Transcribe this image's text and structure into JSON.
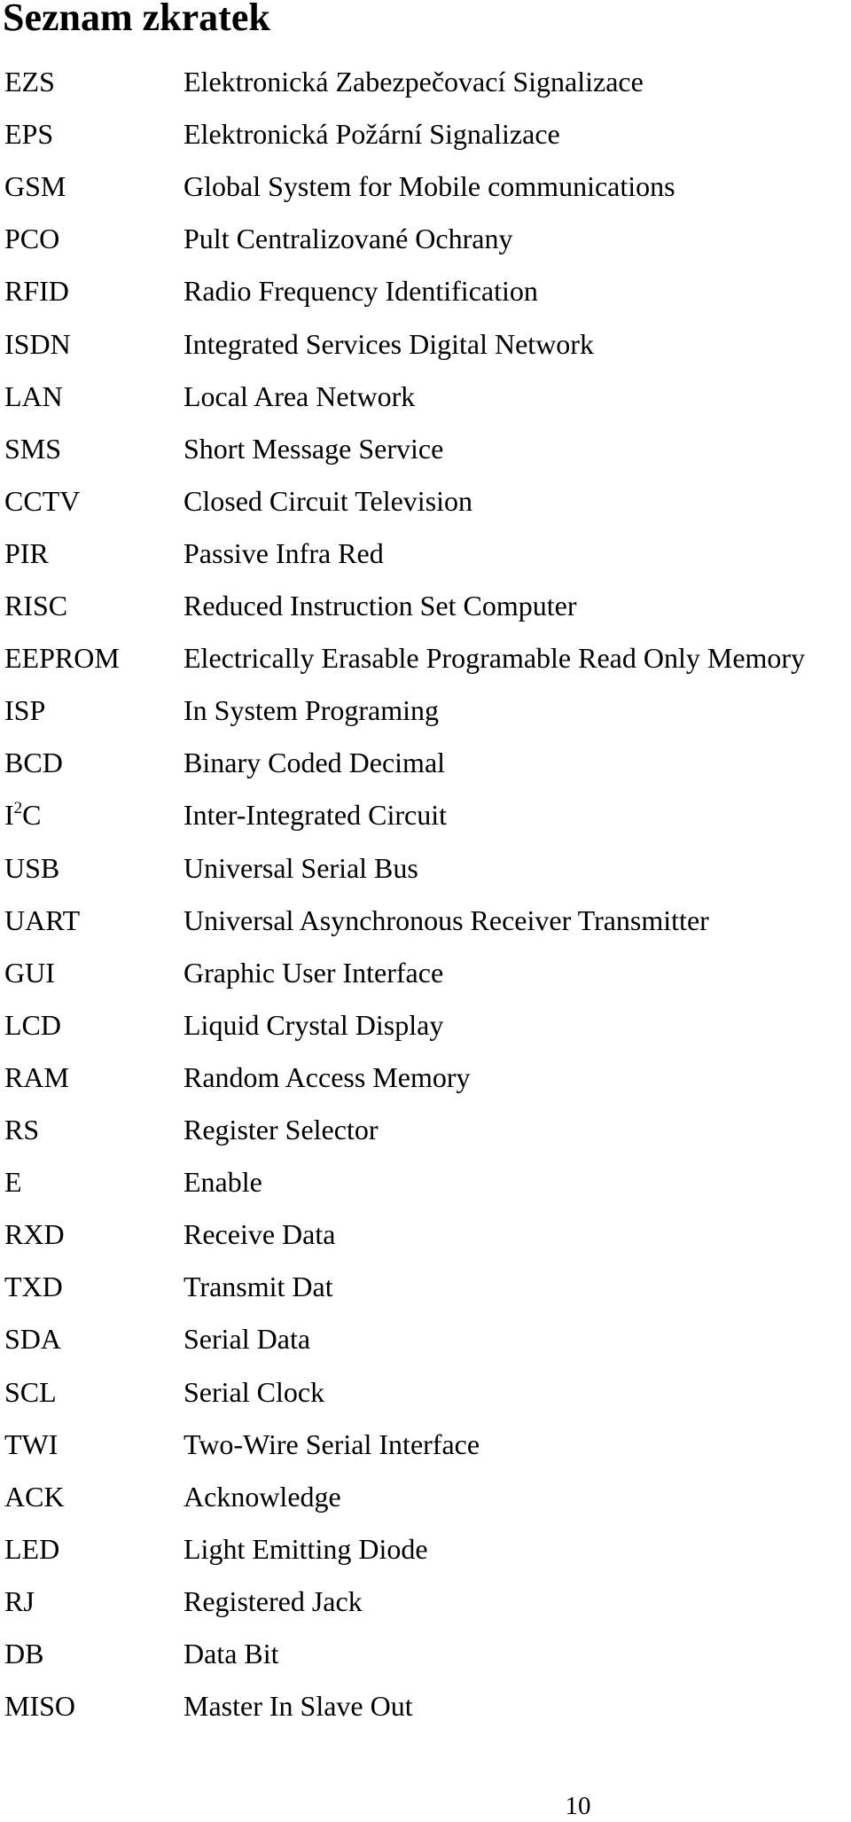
{
  "page": {
    "title": "Seznam zkratek",
    "page_number": "10"
  },
  "abbreviations": [
    {
      "abbr": "EZS",
      "definition": "Elektronická Zabezpečovací Signalizace"
    },
    {
      "abbr": "EPS",
      "definition": "Elektronická Požární Signalizace"
    },
    {
      "abbr": "GSM",
      "definition": "Global System for Mobile communications"
    },
    {
      "abbr": "PCO",
      "definition": "Pult Centralizované Ochrany"
    },
    {
      "abbr": "RFID",
      "definition": "Radio Frequency Identification"
    },
    {
      "abbr": "ISDN",
      "definition": "Integrated Services Digital Network"
    },
    {
      "abbr": "LAN",
      "definition": "Local Area Network"
    },
    {
      "abbr": "SMS",
      "definition": "Short Message Service"
    },
    {
      "abbr": "CCTV",
      "definition": "Closed Circuit Television"
    },
    {
      "abbr": "PIR",
      "definition": "Passive Infra Red"
    },
    {
      "abbr": "RISC",
      "definition": "Reduced Instruction Set Computer"
    },
    {
      "abbr": "EEPROM",
      "definition": "Electrically Erasable Programable Read Only Memory"
    },
    {
      "abbr": "ISP",
      "definition": "In System Programing"
    },
    {
      "abbr": "BCD",
      "definition": "Binary Coded Decimal"
    },
    {
      "abbr": "I",
      "abbr_sup": "2",
      "abbr_suffix": "C",
      "definition": "Inter-Integrated Circuit"
    },
    {
      "abbr": "USB",
      "definition": "Universal Serial Bus"
    },
    {
      "abbr": "UART",
      "definition": "Universal Asynchronous Receiver Transmitter"
    },
    {
      "abbr": "GUI",
      "definition": "Graphic User Interface"
    },
    {
      "abbr": "LCD",
      "definition": "Liquid Crystal Display"
    },
    {
      "abbr": "RAM",
      "definition": "Random Access Memory"
    },
    {
      "abbr": "RS",
      "definition": "Register Selector"
    },
    {
      "abbr": "E",
      "definition": "Enable"
    },
    {
      "abbr": "RXD",
      "definition": "Receive Data"
    },
    {
      "abbr": "TXD",
      "definition": "Transmit Dat"
    },
    {
      "abbr": "SDA",
      "definition": "Serial Data"
    },
    {
      "abbr": "SCL",
      "definition": "Serial Clock"
    },
    {
      "abbr": "TWI",
      "definition": "Two-Wire Serial Interface"
    },
    {
      "abbr": "ACK",
      "definition": "Acknowledge"
    },
    {
      "abbr": "LED",
      "definition": "Light Emitting Diode"
    },
    {
      "abbr": "RJ",
      "definition": "Registered Jack"
    },
    {
      "abbr": "DB",
      "definition": "Data Bit"
    },
    {
      "abbr": "MISO",
      "definition": "Master In Slave Out"
    }
  ]
}
